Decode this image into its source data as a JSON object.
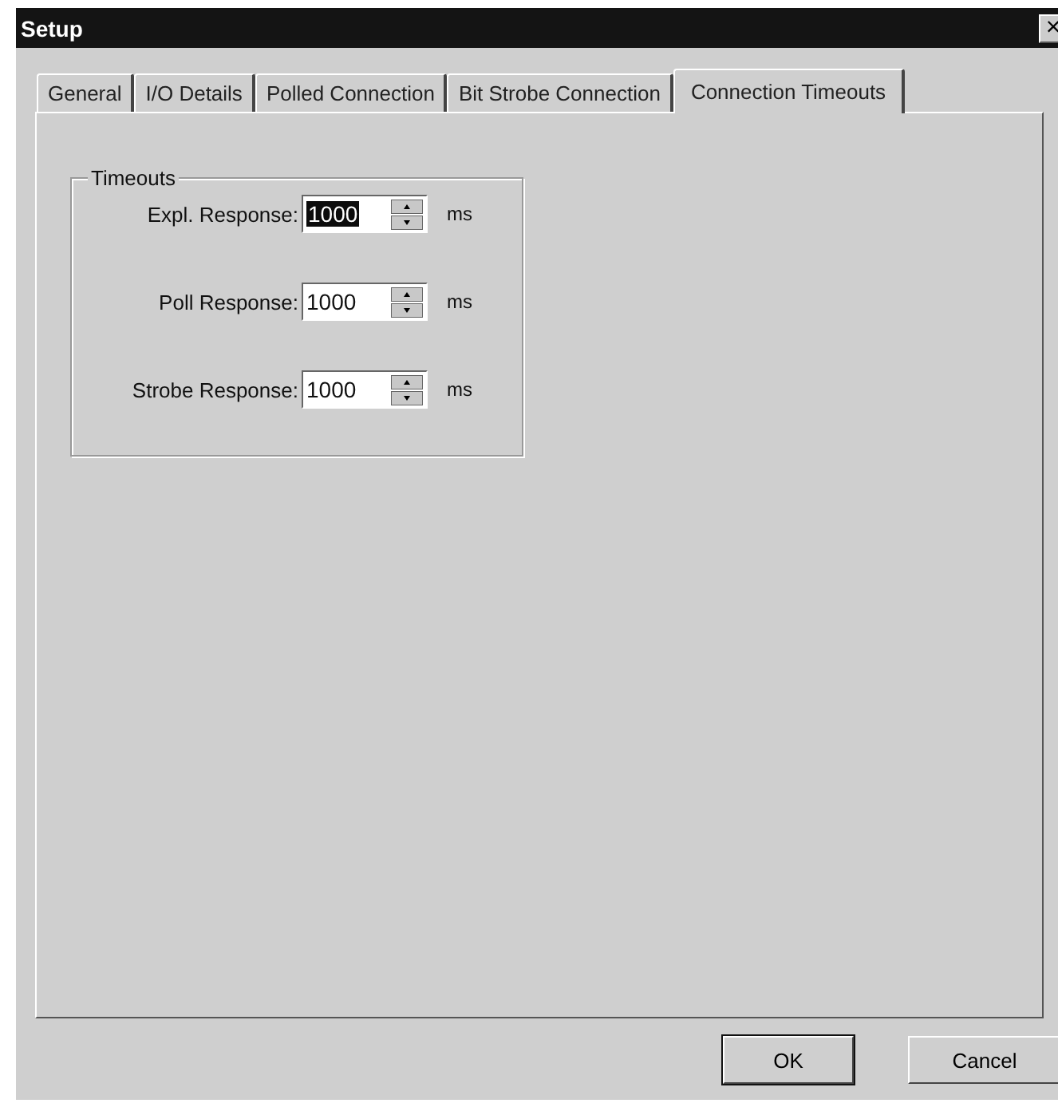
{
  "window": {
    "title": "Setup",
    "close": "×"
  },
  "tabs": [
    {
      "label": "General",
      "selected": false
    },
    {
      "label": "I/O Details",
      "selected": false
    },
    {
      "label": "Polled Connection",
      "selected": false
    },
    {
      "label": "Bit Strobe Connection",
      "selected": false
    },
    {
      "label": "Connection Timeouts",
      "selected": true
    }
  ],
  "group": {
    "title": "Timeouts",
    "fields": [
      {
        "label": "Expl. Response:",
        "value": "1000",
        "highlighted": true,
        "unit": "ms"
      },
      {
        "label": "Poll Response:",
        "value": "1000",
        "highlighted": false,
        "unit": "ms"
      },
      {
        "label": "Strobe Response:",
        "value": "1000",
        "highlighted": false,
        "unit": "ms"
      }
    ]
  },
  "buttons": [
    {
      "label": "OK",
      "default": true
    },
    {
      "label": "Cancel",
      "default": false
    }
  ]
}
